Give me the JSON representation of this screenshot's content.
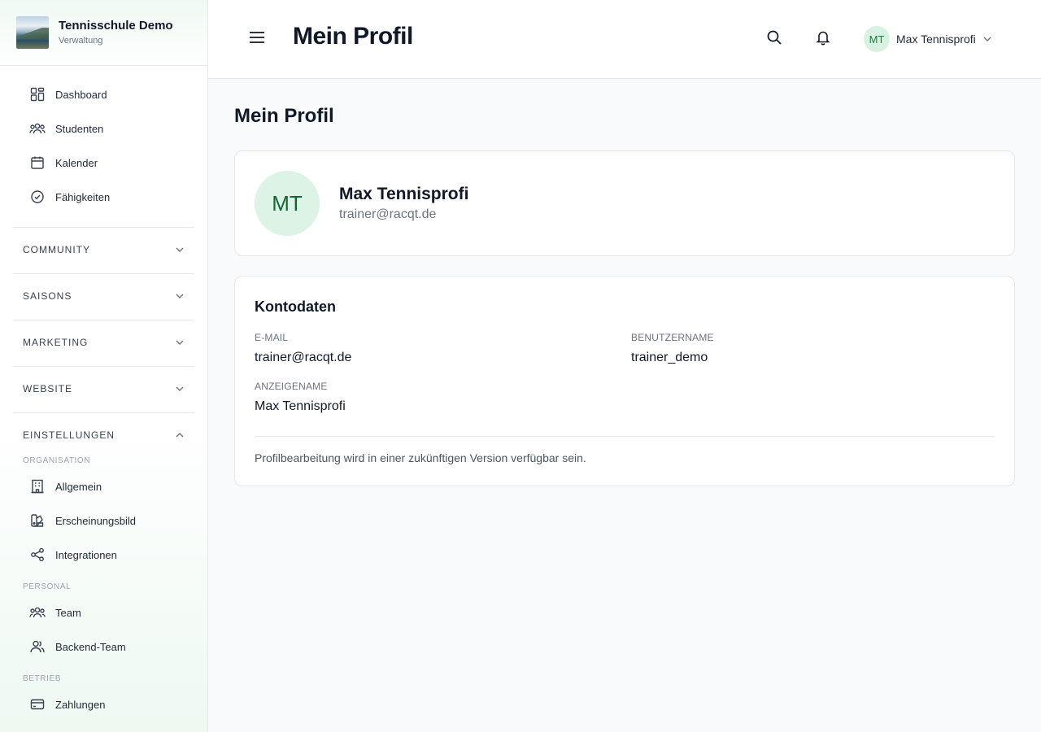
{
  "brand": {
    "name": "Tennisschule Demo",
    "subtitle": "Verwaltung"
  },
  "nav": {
    "main": [
      {
        "label": "Dashboard",
        "icon": "dashboard-icon"
      },
      {
        "label": "Studenten",
        "icon": "users-icon"
      },
      {
        "label": "Kalender",
        "icon": "calendar-icon"
      },
      {
        "label": "Fähigkeiten",
        "icon": "check-badge-icon"
      }
    ],
    "groups": [
      {
        "label": "COMMUNITY",
        "expanded": false
      },
      {
        "label": "SAISONS",
        "expanded": false
      },
      {
        "label": "MARKETING",
        "expanded": false
      },
      {
        "label": "WEBSITE",
        "expanded": false
      },
      {
        "label": "EINSTELLUNGEN",
        "expanded": true
      }
    ],
    "settings": {
      "organisation_label": "ORGANISATION",
      "organisation": [
        {
          "label": "Allgemein",
          "icon": "building-icon"
        },
        {
          "label": "Erscheinungsbild",
          "icon": "palette-icon"
        },
        {
          "label": "Integrationen",
          "icon": "share-icon"
        }
      ],
      "personal_label": "PERSONAL",
      "personal": [
        {
          "label": "Team",
          "icon": "users-icon"
        },
        {
          "label": "Backend-Team",
          "icon": "user-group-icon"
        }
      ],
      "betrieb_label": "BETRIEB",
      "betrieb": [
        {
          "label": "Zahlungen",
          "icon": "credit-card-icon"
        }
      ]
    }
  },
  "header": {
    "title": "Mein Profil",
    "user": {
      "initials": "MT",
      "name": "Max Tennisprofi"
    }
  },
  "main": {
    "title": "Mein Profil",
    "profile": {
      "initials": "MT",
      "name": "Max Tennisprofi",
      "email": "trainer@racqt.de"
    },
    "account": {
      "title": "Kontodaten",
      "email_label": "E-MAIL",
      "email_value": "trainer@racqt.de",
      "username_label": "BENUTZERNAME",
      "username_value": "trainer_demo",
      "display_label": "ANZEIGENAME",
      "display_value": "Max Tennisprofi",
      "note": "Profilbearbeitung wird in einer zukünftigen Version verfügbar sein."
    }
  },
  "colors": {
    "accent": "#15803d",
    "avatar_bg": "#dcf3e6"
  }
}
